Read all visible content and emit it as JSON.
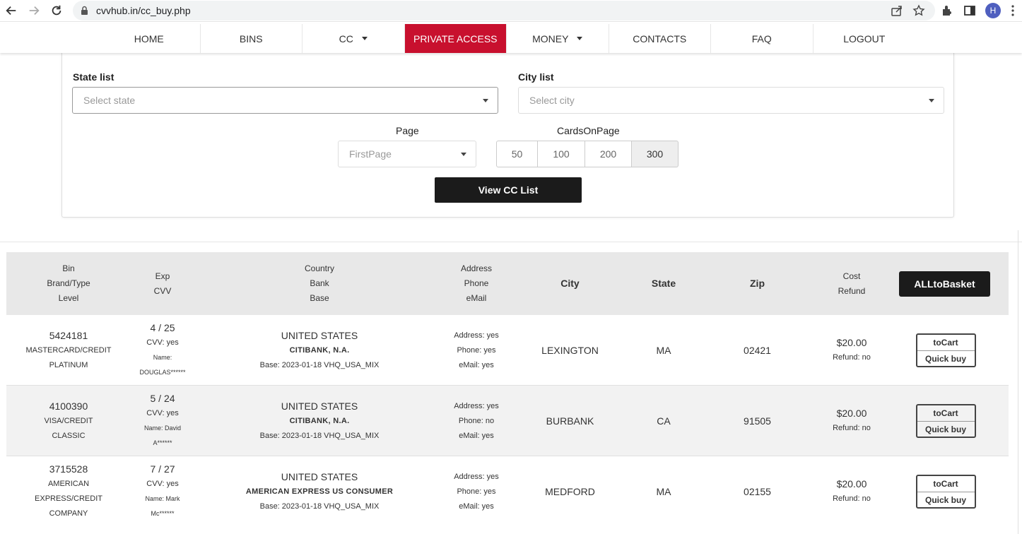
{
  "browser": {
    "url": "cvvhub.in/cc_buy.php",
    "avatar_letter": "H"
  },
  "nav": {
    "items": [
      {
        "label": "HOME",
        "dropdown": false,
        "highlight": false
      },
      {
        "label": "BINS",
        "dropdown": false,
        "highlight": false
      },
      {
        "label": "CC",
        "dropdown": true,
        "highlight": false
      },
      {
        "label": "PRIVATE ACCESS",
        "dropdown": false,
        "highlight": true
      },
      {
        "label": "MONEY",
        "dropdown": true,
        "highlight": false
      },
      {
        "label": "CONTACTS",
        "dropdown": false,
        "highlight": false
      },
      {
        "label": "FAQ",
        "dropdown": false,
        "highlight": false
      },
      {
        "label": "LOGOUT",
        "dropdown": false,
        "highlight": false
      }
    ],
    "highlight_color": "#c8102e"
  },
  "filters": {
    "state_label": "State list",
    "state_placeholder": "Select state",
    "city_label": "City list",
    "city_placeholder": "Select city",
    "page_label": "Page",
    "page_value": "FirstPage",
    "cards_label": "CardsOnPage",
    "cards_options": [
      "50",
      "100",
      "200",
      "300"
    ],
    "cards_selected": "300",
    "view_button": "View CC List"
  },
  "table": {
    "headers": {
      "bin": [
        "Bin",
        "Brand/Type",
        "Level"
      ],
      "exp": [
        "Exp",
        "CVV"
      ],
      "country": [
        "Country",
        "Bank",
        "Base"
      ],
      "address": [
        "Address",
        "Phone",
        "eMail"
      ],
      "city": "City",
      "state": "State",
      "zip": "Zip",
      "cost": [
        "Cost",
        "Refund"
      ],
      "all_button": "ALLtoBasket"
    },
    "rows": [
      {
        "bin": "5424181",
        "brand": "MASTERCARD/CREDIT",
        "level": "PLATINUM",
        "exp": "4 / 25",
        "cvv": "CVV: yes",
        "name1": "Name:",
        "name2": "DOUGLAS******",
        "country": "UNITED STATES",
        "bank": "CITIBANK, N.A.",
        "base": "Base: 2023-01-18 VHQ_USA_MIX",
        "address": "Address: yes",
        "phone": "Phone: yes",
        "email": "eMail: yes",
        "city": "LEXINGTON",
        "state": "MA",
        "zip": "02421",
        "cost": "$20.00",
        "refund": "Refund: no",
        "to_cart": "toCart",
        "quick_buy": "Quick buy"
      },
      {
        "bin": "4100390",
        "brand": "VISA/CREDIT",
        "level": "CLASSIC",
        "exp": "5 / 24",
        "cvv": "CVV: yes",
        "name1": "Name: David",
        "name2": "A******",
        "country": "UNITED STATES",
        "bank": "CITIBANK, N.A.",
        "base": "Base: 2023-01-18 VHQ_USA_MIX",
        "address": "Address: yes",
        "phone": "Phone: no",
        "email": "eMail: yes",
        "city": "BURBANK",
        "state": "CA",
        "zip": "91505",
        "cost": "$20.00",
        "refund": "Refund: no",
        "to_cart": "toCart",
        "quick_buy": "Quick buy"
      },
      {
        "bin": "3715528",
        "brand": "AMERICAN EXPRESS/CREDIT",
        "brand_l1": "AMERICAN",
        "brand_l2": "EXPRESS/CREDIT",
        "level": "COMPANY",
        "exp": "7 / 27",
        "cvv": "CVV: yes",
        "name1": "Name: Mark",
        "name2": "Mc******",
        "country": "UNITED STATES",
        "bank": "AMERICAN EXPRESS US CONSUMER",
        "base": "Base: 2023-01-18 VHQ_USA_MIX",
        "address": "Address: yes",
        "phone": "Phone: yes",
        "email": "eMail: yes",
        "city": "MEDFORD",
        "state": "MA",
        "zip": "02155",
        "cost": "$20.00",
        "refund": "Refund: no",
        "to_cart": "toCart",
        "quick_buy": "Quick buy"
      }
    ]
  }
}
